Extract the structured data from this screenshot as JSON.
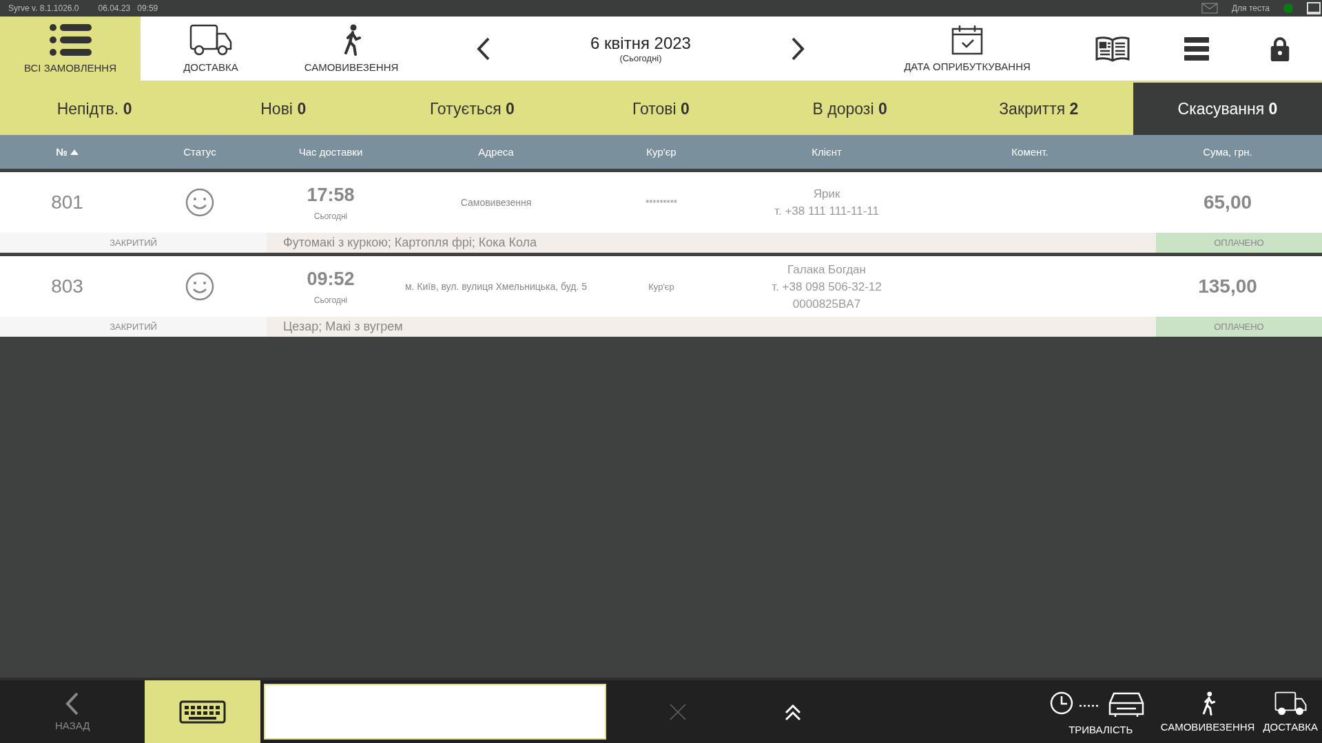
{
  "status_bar": {
    "version": "Syrve  v. 8.1.1026.0",
    "date": "06.04.23",
    "time": "09:59",
    "terminal": "Для теста",
    "connected": true
  },
  "toolbar": {
    "tabs": [
      {
        "label": "ВСІ ЗАМОВЛЕННЯ",
        "kind": "list",
        "selected": true
      },
      {
        "label": "ДОСТАВКА",
        "kind": "truck",
        "selected": false
      },
      {
        "label": "САМОВИВЕЗЕННЯ",
        "kind": "walker",
        "selected": false
      }
    ],
    "date": {
      "text": "6 квітня 2023",
      "subtitle": "(Сьогодні)"
    },
    "accounting_date": "ДАТА ОПРИБУТКУВАННЯ"
  },
  "filters": [
    {
      "label": "Непідтв.",
      "count": "0",
      "selected": false
    },
    {
      "label": "Нові",
      "count": "0",
      "selected": false
    },
    {
      "label": "Готується",
      "count": "0",
      "selected": false
    },
    {
      "label": "Готові",
      "count": "0",
      "selected": false
    },
    {
      "label": "В дорозі",
      "count": "0",
      "selected": false
    },
    {
      "label": "Закриття",
      "count": "2",
      "selected": false
    },
    {
      "label": "Скасування",
      "count": "0",
      "selected": true
    }
  ],
  "table": {
    "columns": [
      {
        "label": "№",
        "sorted": true
      },
      {
        "label": "Статус",
        "sorted": false
      },
      {
        "label": "Час доставки",
        "sorted": false
      },
      {
        "label": "Адреса",
        "sorted": false
      },
      {
        "label": "Кур'єр",
        "sorted": false
      },
      {
        "label": "Клієнт",
        "sorted": false
      },
      {
        "label": "Комент.",
        "sorted": false
      },
      {
        "label": "Сума, грн.",
        "sorted": false
      }
    ],
    "rows": [
      {
        "number": "801",
        "time": "17:58",
        "day": "Сьогодні",
        "address": "Самовивезення",
        "courier": "*********",
        "client": [
          "Ярик",
          "т. +38 111 111-11-11"
        ],
        "sum": "65,00",
        "status": "ЗАКРИТИЙ",
        "items": "Футомакі з куркою; Картопля фрі; Кока Кола",
        "payment": "ОПЛАЧЕНО"
      },
      {
        "number": "803",
        "time": "09:52",
        "day": "Сьогодні",
        "address": "м. Київ, вул. вулиця Хмельницька, буд. 5",
        "courier": "Кур'єр",
        "client": [
          "Галака Богдан",
          "т. +38 098 506-32-12",
          "0000825BA7"
        ],
        "sum": "135,00",
        "status": "ЗАКРИТИЙ",
        "items": "Цезар; Макі з вугрем",
        "payment": "ОПЛАЧЕНО"
      }
    ]
  },
  "bottom_bar": {
    "back": "НАЗАД",
    "actions": [
      {
        "label": "ТРИВАЛІСТЬ",
        "kind": "duration"
      },
      {
        "label": "САМОВИВЕЗЕННЯ",
        "kind": "walker"
      },
      {
        "label": "ДОСТАВКА",
        "kind": "truck"
      }
    ]
  }
}
